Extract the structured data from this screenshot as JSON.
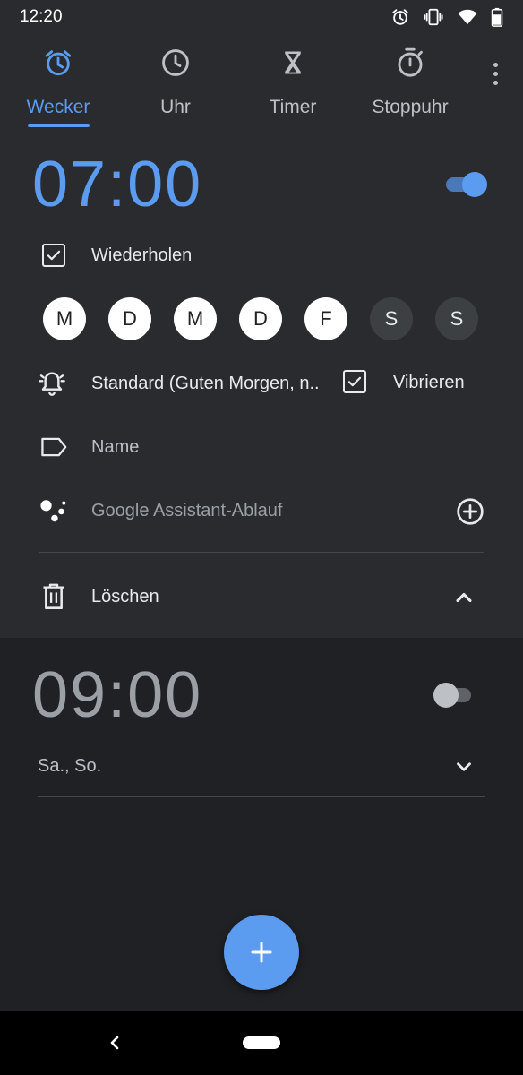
{
  "status_bar": {
    "time": "12:20",
    "icons": [
      "alarm-icon",
      "vibrate-icon",
      "wifi-icon",
      "battery-icon"
    ]
  },
  "tabs": [
    {
      "label": "Wecker",
      "icon": "alarm-clock-icon",
      "active": true
    },
    {
      "label": "Uhr",
      "icon": "clock-icon",
      "active": false
    },
    {
      "label": "Timer",
      "icon": "hourglass-icon",
      "active": false
    },
    {
      "label": "Stoppuhr",
      "icon": "stopwatch-icon",
      "active": false
    }
  ],
  "colors": {
    "accent": "#5b9bf0",
    "background": "#202124",
    "card": "#2a2b2e",
    "text": "#e8eaed",
    "muted": "#9aa0a6"
  },
  "alarms": [
    {
      "time": "07:00",
      "enabled": true,
      "expanded": true,
      "repeat_label": "Wiederholen",
      "repeat_checked": true,
      "days": [
        {
          "label": "M",
          "selected": true
        },
        {
          "label": "D",
          "selected": true
        },
        {
          "label": "M",
          "selected": true
        },
        {
          "label": "D",
          "selected": true
        },
        {
          "label": "F",
          "selected": true
        },
        {
          "label": "S",
          "selected": false
        },
        {
          "label": "S",
          "selected": false
        }
      ],
      "ringtone": "Standard (Guten Morgen, n..",
      "vibrate_label": "Vibrieren",
      "vibrate_checked": true,
      "name_label": "Name",
      "assistant_label": "Google Assistant-Ablauf",
      "delete_label": "Löschen"
    },
    {
      "time": "09:00",
      "enabled": false,
      "expanded": false,
      "days_summary": "Sa., So."
    }
  ]
}
